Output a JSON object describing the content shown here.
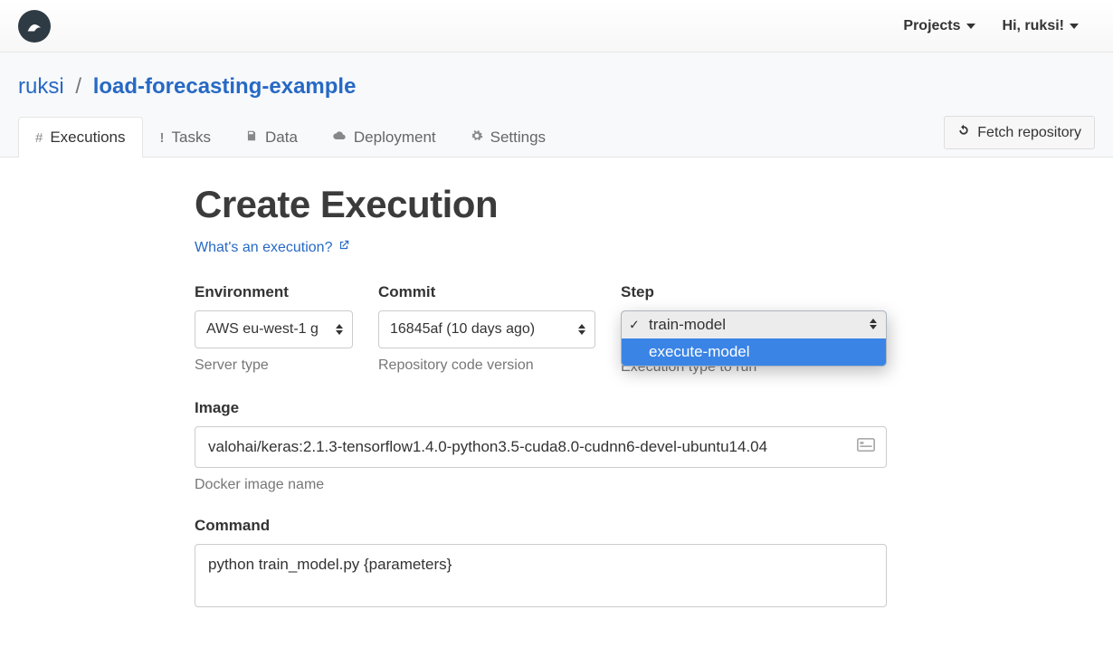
{
  "topnav": {
    "projects": "Projects",
    "greeting": "Hi, ruksi!"
  },
  "breadcrumb": {
    "owner": "ruksi",
    "sep": "/",
    "project": "load-forecasting-example"
  },
  "tabs": [
    {
      "id": "executions",
      "label": "Executions"
    },
    {
      "id": "tasks",
      "label": "Tasks"
    },
    {
      "id": "data",
      "label": "Data"
    },
    {
      "id": "deployment",
      "label": "Deployment"
    },
    {
      "id": "settings",
      "label": "Settings"
    }
  ],
  "fetch_button": "Fetch repository",
  "page_title": "Create Execution",
  "help_link": "What's an execution?",
  "form": {
    "environment": {
      "label": "Environment",
      "value": "AWS eu-west-1 g",
      "hint": "Server type"
    },
    "commit": {
      "label": "Commit",
      "value": "16845af (10 days ago)",
      "hint": "Repository code version"
    },
    "step": {
      "label": "Step",
      "hint": "Execution type to run",
      "options": [
        {
          "value": "train-model",
          "selected": true,
          "highlighted": false
        },
        {
          "value": "execute-model",
          "selected": false,
          "highlighted": true
        }
      ]
    },
    "image": {
      "label": "Image",
      "value": "valohai/keras:2.1.3-tensorflow1.4.0-python3.5-cuda8.0-cudnn6-devel-ubuntu14.04",
      "hint": "Docker image name"
    },
    "command": {
      "label": "Command",
      "value": "python train_model.py {parameters}"
    }
  }
}
